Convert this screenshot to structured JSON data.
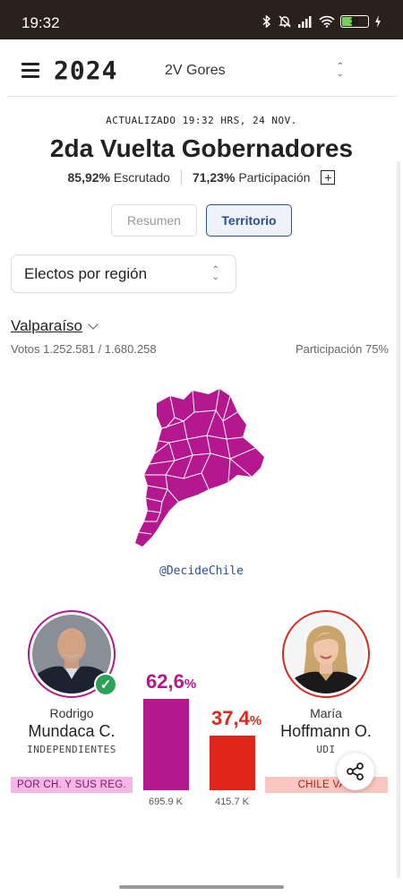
{
  "status_bar": {
    "time": "19:32",
    "battery": "37"
  },
  "header": {
    "year": "2024",
    "election_select": "2V Gores"
  },
  "updated": "ACTUALIZADO 19:32 HRS, 24 NOV.",
  "title": "2da Vuelta Gobernadores",
  "stats": {
    "scrutinized_value": "85,92%",
    "scrutinized_label": "Escrutado",
    "participation_value": "71,23%",
    "participation_label": "Participación",
    "plus": "+"
  },
  "tabs": [
    {
      "label": "Resumen",
      "active": false
    },
    {
      "label": "Territorio",
      "active": true
    }
  ],
  "region_select": "Electos por región",
  "region": {
    "name": "Valparaíso",
    "votes": "Votos 1.252.581 / 1.680.258",
    "participation": "Participación 75%"
  },
  "map": {
    "color": "#b5178e",
    "credit": "@DecideChile"
  },
  "candidates": [
    {
      "first": "Rodrigo",
      "last": "Mundaca C.",
      "party": "INDEPENDIENTES",
      "coalition": "POR CH. Y SUS REG.",
      "pct": "62,6",
      "pct_symbol": "%",
      "share": 62.6,
      "votes": "695.9 K",
      "color": "#b5178e",
      "coalition_bg": "#f2b8e3",
      "coalition_color": "#8a1070",
      "winner": true
    },
    {
      "first": "María",
      "last": "Hoffmann O.",
      "party": "UDI",
      "coalition": "CHILE VAM",
      "pct": "37,4",
      "pct_symbol": "%",
      "share": 37.4,
      "votes": "415.7 K",
      "color": "#e0261b",
      "coalition_bg": "#f9c6c0",
      "coalition_color": "#b51f16",
      "winner": false
    }
  ]
}
